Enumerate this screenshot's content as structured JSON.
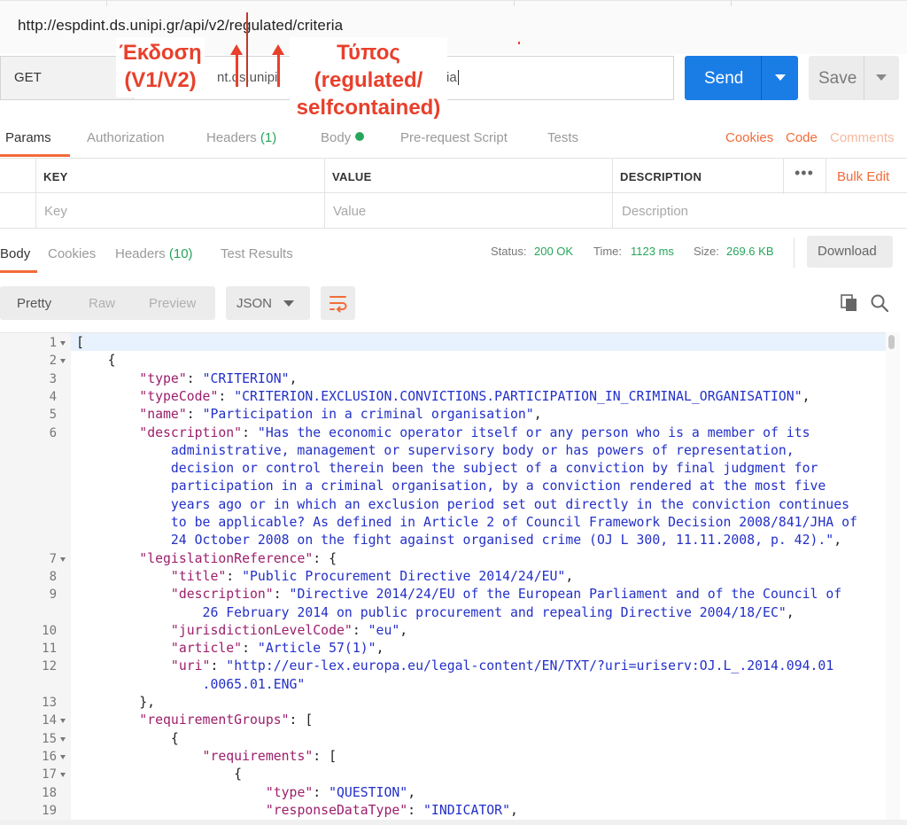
{
  "window": {
    "url": "http://espdint.ds.unipi.gr/api/v2/regulated/criteria"
  },
  "request": {
    "method": "GET",
    "url_fragment_left": "nt.ds.unipi.",
    "url_fragment_right": "ia",
    "send_label": "Send",
    "save_label": "Save"
  },
  "annotations": {
    "version_line1": "Έκδοση",
    "version_line2": "(V1/V2)",
    "type_line1": "Τύπος",
    "type_line2": "(regulated/",
    "type_line3": "selfcontained)",
    "color": "#e8402c"
  },
  "request_tabs": {
    "params": "Params",
    "authorization": "Authorization",
    "headers": "Headers",
    "headers_count": "(1)",
    "body": "Body",
    "prerequest": "Pre-request Script",
    "tests": "Tests",
    "cookies": "Cookies",
    "code": "Code",
    "comments": "Comments"
  },
  "params_table": {
    "col_key": "KEY",
    "col_value": "VALUE",
    "col_description": "DESCRIPTION",
    "bulk_edit": "Bulk Edit",
    "more": "•••",
    "ph_key": "Key",
    "ph_value": "Value",
    "ph_description": "Description"
  },
  "response_tabs": {
    "body": "Body",
    "cookies": "Cookies",
    "headers": "Headers",
    "headers_count": "(10)",
    "test_results": "Test Results"
  },
  "status": {
    "status_label": "Status:",
    "status_value": "200 OK",
    "time_label": "Time:",
    "time_value": "1123 ms",
    "size_label": "Size:",
    "size_value": "269.6 KB",
    "download_label": "Download"
  },
  "viewer": {
    "pretty": "Pretty",
    "raw": "Raw",
    "preview": "Preview",
    "format": "JSON"
  },
  "code_lines": [
    {
      "num": "1",
      "fold": true,
      "parts": [
        [
          "p",
          "["
        ]
      ]
    },
    {
      "num": "2",
      "fold": true,
      "parts": [
        [
          "p",
          "    {"
        ]
      ]
    },
    {
      "num": "3",
      "fold": false,
      "parts": [
        [
          "p",
          "        "
        ],
        [
          "k",
          "\"type\""
        ],
        [
          "p",
          ": "
        ],
        [
          "s",
          "\"CRITERION\""
        ],
        [
          "p",
          ","
        ]
      ]
    },
    {
      "num": "4",
      "fold": false,
      "parts": [
        [
          "p",
          "        "
        ],
        [
          "k",
          "\"typeCode\""
        ],
        [
          "p",
          ": "
        ],
        [
          "s",
          "\"CRITERION.EXCLUSION.CONVICTIONS.PARTICIPATION_IN_CRIMINAL_ORGANISATION\""
        ],
        [
          "p",
          ","
        ]
      ]
    },
    {
      "num": "5",
      "fold": false,
      "parts": [
        [
          "p",
          "        "
        ],
        [
          "k",
          "\"name\""
        ],
        [
          "p",
          ": "
        ],
        [
          "s",
          "\"Participation in a criminal organisation\""
        ],
        [
          "p",
          ","
        ]
      ]
    },
    {
      "num": "6",
      "fold": false,
      "parts": [
        [
          "p",
          "        "
        ],
        [
          "k",
          "\"description\""
        ],
        [
          "p",
          ": "
        ],
        [
          "s",
          "\"Has the economic operator itself or any person who is a member of its"
        ]
      ]
    },
    {
      "num": "",
      "fold": false,
      "parts": [
        [
          "s",
          "            administrative, management or supervisory body or has powers of representation,"
        ]
      ]
    },
    {
      "num": "",
      "fold": false,
      "parts": [
        [
          "s",
          "            decision or control therein been the subject of a conviction by final judgment for"
        ]
      ]
    },
    {
      "num": "",
      "fold": false,
      "parts": [
        [
          "s",
          "            participation in a criminal organisation, by a conviction rendered at the most five"
        ]
      ]
    },
    {
      "num": "",
      "fold": false,
      "parts": [
        [
          "s",
          "            years ago or in which an exclusion period set out directly in the conviction continues"
        ]
      ]
    },
    {
      "num": "",
      "fold": false,
      "parts": [
        [
          "s",
          "            to be applicable? As defined in Article 2 of Council Framework Decision 2008/841/JHA of"
        ]
      ]
    },
    {
      "num": "",
      "fold": false,
      "parts": [
        [
          "s",
          "            24 October 2008 on the fight against organised crime (OJ L 300, 11.11.2008, p. 42).\""
        ],
        [
          "p",
          ","
        ]
      ]
    },
    {
      "num": "7",
      "fold": true,
      "parts": [
        [
          "p",
          "        "
        ],
        [
          "k",
          "\"legislationReference\""
        ],
        [
          "p",
          ": {"
        ]
      ]
    },
    {
      "num": "8",
      "fold": false,
      "parts": [
        [
          "p",
          "            "
        ],
        [
          "k",
          "\"title\""
        ],
        [
          "p",
          ": "
        ],
        [
          "s",
          "\"Public Procurement Directive 2014/24/EU\""
        ],
        [
          "p",
          ","
        ]
      ]
    },
    {
      "num": "9",
      "fold": false,
      "parts": [
        [
          "p",
          "            "
        ],
        [
          "k",
          "\"description\""
        ],
        [
          "p",
          ": "
        ],
        [
          "s",
          "\"Directive 2014/24/EU of the European Parliament and of the Council of"
        ]
      ]
    },
    {
      "num": "",
      "fold": false,
      "parts": [
        [
          "s",
          "                26 February 2014 on public procurement and repealing Directive 2004/18/EC\""
        ],
        [
          "p",
          ","
        ]
      ]
    },
    {
      "num": "10",
      "fold": false,
      "parts": [
        [
          "p",
          "            "
        ],
        [
          "k",
          "\"jurisdictionLevelCode\""
        ],
        [
          "p",
          ": "
        ],
        [
          "s",
          "\"eu\""
        ],
        [
          "p",
          ","
        ]
      ]
    },
    {
      "num": "11",
      "fold": false,
      "parts": [
        [
          "p",
          "            "
        ],
        [
          "k",
          "\"article\""
        ],
        [
          "p",
          ": "
        ],
        [
          "s",
          "\"Article 57(1)\""
        ],
        [
          "p",
          ","
        ]
      ]
    },
    {
      "num": "12",
      "fold": false,
      "parts": [
        [
          "p",
          "            "
        ],
        [
          "k",
          "\"uri\""
        ],
        [
          "p",
          ": "
        ],
        [
          "s",
          "\"http://eur-lex.europa.eu/legal-content/EN/TXT/?uri=uriserv:OJ.L_.2014.094.01"
        ]
      ]
    },
    {
      "num": "",
      "fold": false,
      "parts": [
        [
          "s",
          "                .0065.01.ENG\""
        ]
      ]
    },
    {
      "num": "13",
      "fold": false,
      "parts": [
        [
          "p",
          "        },"
        ]
      ]
    },
    {
      "num": "14",
      "fold": true,
      "parts": [
        [
          "p",
          "        "
        ],
        [
          "k",
          "\"requirementGroups\""
        ],
        [
          "p",
          ": ["
        ]
      ]
    },
    {
      "num": "15",
      "fold": true,
      "parts": [
        [
          "p",
          "            {"
        ]
      ]
    },
    {
      "num": "16",
      "fold": true,
      "parts": [
        [
          "p",
          "                "
        ],
        [
          "k",
          "\"requirements\""
        ],
        [
          "p",
          ": ["
        ]
      ]
    },
    {
      "num": "17",
      "fold": true,
      "parts": [
        [
          "p",
          "                    {"
        ]
      ]
    },
    {
      "num": "18",
      "fold": false,
      "parts": [
        [
          "p",
          "                        "
        ],
        [
          "k",
          "\"type\""
        ],
        [
          "p",
          ": "
        ],
        [
          "s",
          "\"QUESTION\""
        ],
        [
          "p",
          ","
        ]
      ]
    },
    {
      "num": "19",
      "fold": false,
      "parts": [
        [
          "p",
          "                        "
        ],
        [
          "k",
          "\"responseDataType\""
        ],
        [
          "p",
          ": "
        ],
        [
          "s",
          "\"INDICATOR\""
        ],
        [
          "p",
          ","
        ]
      ]
    }
  ]
}
